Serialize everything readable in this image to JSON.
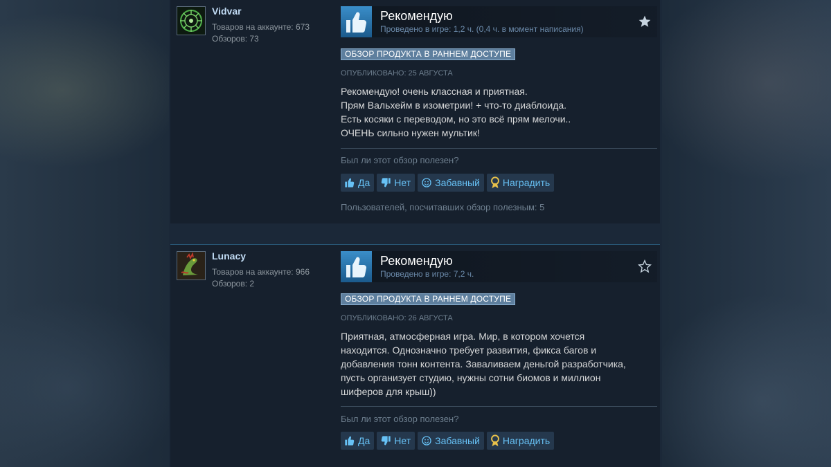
{
  "reviews": [
    {
      "author": "Vidvar",
      "products": "Товаров на аккаунте: 673",
      "reviews_count": "Обзоров: 73",
      "verdict": "Рекомендую",
      "playtime": "Проведено в игре: 1,2 ч. (0,4 ч. в момент написания)",
      "badge": "ОБЗОР ПРОДУКТА В РАННЕМ ДОСТУПЕ",
      "posted": "ОПУБЛИКОВАНО: 25 АВГУСТА",
      "lines": [
        "Рекомендую! очень классная и приятная.",
        "Прям Вальхейм в изометрии! + что-то диаблоида.",
        "Есть косяки с переводом, но это всё прям мелочи..",
        "ОЧЕНЬ сильно нужен мультик!"
      ],
      "helpful_question": "Был ли этот обзор полезен?",
      "buttons": {
        "yes": "Да",
        "no": "Нет",
        "funny": "Забавный",
        "award": "Наградить"
      },
      "helpful_count": "Пользователей, посчитавших обзор полезным: 5",
      "starred": true
    },
    {
      "author": "Lunacy",
      "products": "Товаров на аккаунте: 966",
      "reviews_count": "Обзоров: 2",
      "verdict": "Рекомендую",
      "playtime": "Проведено в игре: 7,2 ч.",
      "badge": "ОБЗОР ПРОДУКТА В РАННЕМ ДОСТУПЕ",
      "posted": "ОПУБЛИКОВАНО: 26 АВГУСТА",
      "lines": [
        "Приятная, атмосферная игра. Мир, в котором хочется",
        "находится. Однозначно требует развития, фикса багов и",
        "добавления тонн контента. Заваливаем деньгой разработчика,",
        "пусть организует студию, нужны сотни биомов и миллион",
        "шиферов для крыш))"
      ],
      "helpful_question": "Был ли этот обзор полезен?",
      "buttons": {
        "yes": "Да",
        "no": "Нет",
        "funny": "Забавный",
        "award": "Наградить"
      },
      "starred": false
    }
  ],
  "colors": {
    "page_bg": "#1b2838",
    "review_bg": "#16202d",
    "link_blue": "#67c1f5",
    "badge_bg": "#5e7f9e",
    "author_name": "#c1dbf4",
    "award_gold": "#e8c14a"
  },
  "icons": {
    "thumbs_up": "thumbs-up-icon",
    "thumbs_down": "thumbs-down-icon",
    "funny": "smiley-icon",
    "award": "award-ribbon-icon",
    "favorite": "star-icon"
  }
}
